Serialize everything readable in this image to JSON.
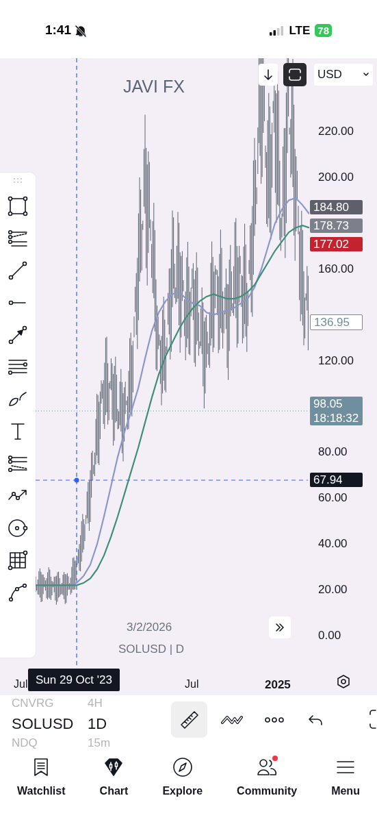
{
  "status_bar": {
    "time": "1:41",
    "network": "LTE",
    "battery": "78"
  },
  "chart": {
    "watermark": "JAVI FX",
    "currency": "USD",
    "price_tags": [
      {
        "lines": [
          "184.80"
        ],
        "kind": "filled",
        "color": "#5d606b"
      },
      {
        "lines": [
          "178.73"
        ],
        "kind": "filled",
        "color": "#7c808b"
      },
      {
        "lines": [
          "177.02"
        ],
        "kind": "filled",
        "color": "#c4222e"
      },
      {
        "lines": [
          "136.95"
        ],
        "kind": "outline",
        "color": "#6f8f9e"
      },
      {
        "lines": [
          "98.05",
          "18:18:32"
        ],
        "kind": "filled",
        "color": "#6f8f9e"
      },
      {
        "lines": [
          "67.94"
        ],
        "kind": "filled",
        "color": "#131722"
      }
    ],
    "date_label": "3/2/2026",
    "symbol_label": "SOLUSD | D",
    "time_axis": [
      {
        "label": "Jul",
        "kind": "month"
      },
      {
        "label": "Jul",
        "kind": "month"
      },
      {
        "label": "2025",
        "kind": "year"
      }
    ],
    "crosshair_date": "Sun 29 Oct '23",
    "chart_data": {
      "type": "line",
      "ylim": [
        0,
        220
      ],
      "yticks": [
        {
          "value": 220,
          "label": "220.00"
        },
        {
          "value": 200,
          "label": "200.00"
        },
        {
          "value": 160,
          "label": "160.00"
        },
        {
          "value": 120,
          "label": "120.00"
        },
        {
          "value": 80,
          "label": "80.00"
        },
        {
          "value": 60,
          "label": "60.00"
        },
        {
          "value": 40,
          "label": "40.00"
        },
        {
          "value": 20,
          "label": "20.00"
        },
        {
          "value": 0,
          "label": "0.00"
        }
      ],
      "series": [
        {
          "color": "#8c97c9",
          "values": [
            22,
            22,
            22,
            22,
            22,
            22,
            23,
            26,
            31,
            40,
            52,
            65,
            78,
            89,
            98,
            108,
            121,
            133,
            141,
            146,
            149,
            150,
            147,
            145,
            144,
            141,
            140,
            141,
            142,
            143,
            145,
            147,
            152,
            160,
            170,
            180,
            186,
            190,
            191,
            188,
            184
          ]
        },
        {
          "color": "#3f8f78",
          "values": [
            22,
            22,
            22,
            22,
            22,
            22,
            22,
            23,
            25,
            29,
            35,
            43,
            52,
            62,
            72,
            82,
            93,
            104,
            114,
            122,
            128,
            134,
            139,
            143,
            146,
            148,
            149,
            148,
            147,
            147,
            148,
            150,
            153,
            158,
            163,
            168,
            172,
            176,
            178,
            179,
            178
          ]
        }
      ]
    }
  },
  "symbols": [
    {
      "symbol": "CNVRG",
      "interval": "4H",
      "selected": false
    },
    {
      "symbol": "SOLUSD",
      "interval": "1D",
      "selected": true
    },
    {
      "symbol": "NDQ",
      "interval": "15m",
      "selected": false
    }
  ],
  "toolbar": [
    {
      "kind": "ruler",
      "selected": true
    },
    {
      "kind": "pattern",
      "selected": false
    },
    {
      "kind": "more",
      "selected": false
    },
    {
      "kind": "undo",
      "selected": false
    }
  ],
  "tabs": [
    {
      "label": "Watchlist",
      "kind": "watchlist",
      "notification": false
    },
    {
      "label": "Chart",
      "kind": "chart",
      "notification": false
    },
    {
      "label": "Explore",
      "kind": "explore",
      "notification": false
    },
    {
      "label": "Community",
      "kind": "community",
      "notification": true
    },
    {
      "label": "Menu",
      "kind": "menu",
      "notification": false
    }
  ]
}
